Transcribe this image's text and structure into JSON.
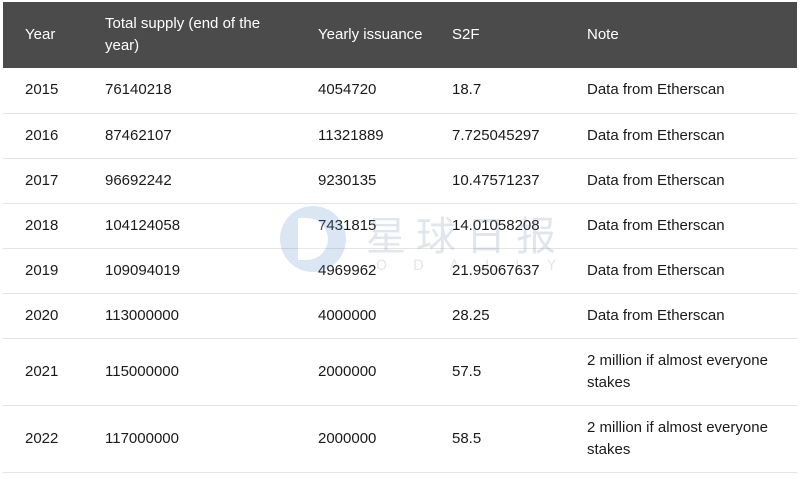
{
  "table": {
    "headers": [
      "Year",
      "Total supply (end of the year)",
      "Yearly issuance",
      "S2F",
      "Note"
    ],
    "rows": [
      [
        "2015",
        "76140218",
        "4054720",
        "18.7",
        "Data from Etherscan"
      ],
      [
        "2016",
        "87462107",
        "11321889",
        "7.725045297",
        "Data from Etherscan"
      ],
      [
        "2017",
        "96692242",
        "9230135",
        "10.47571237",
        "Data from Etherscan"
      ],
      [
        "2018",
        "104124058",
        "7431815",
        "14.01058208",
        "Data from Etherscan"
      ],
      [
        "2019",
        "109094019",
        "4969962",
        "21.95067637",
        "Data from Etherscan"
      ],
      [
        "2020",
        "113000000",
        "4000000",
        "28.25",
        "Data from Etherscan"
      ],
      [
        "2021",
        "115000000",
        "2000000",
        "57.5",
        "2 million if almost everyone stakes"
      ],
      [
        "2022",
        "117000000",
        "2000000",
        "58.5",
        "2 million if almost everyone stakes"
      ]
    ]
  },
  "watermark": {
    "text_cn": "星球日报",
    "text_en": "ODAILY"
  }
}
